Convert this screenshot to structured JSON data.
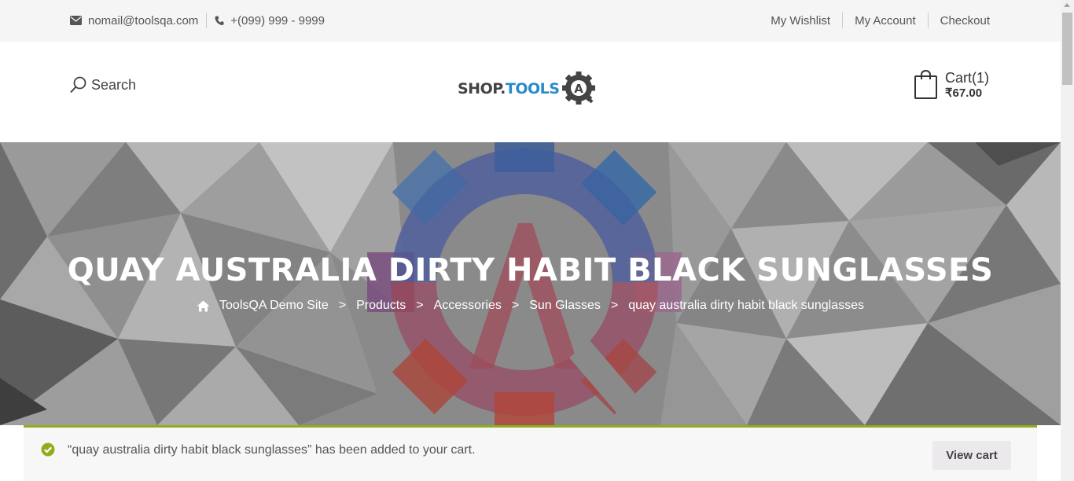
{
  "topbar": {
    "email": "nomail@toolsqa.com",
    "phone": "+(099) 999 - 9999",
    "links": [
      "My Wishlist",
      "My Account",
      "Checkout"
    ]
  },
  "header": {
    "search_label": "Search",
    "logo_part1": "SHOP.",
    "logo_part2": "TOOLS",
    "logo_badge": "A",
    "cart_label": "Cart(1)",
    "cart_amount": "₹67.00"
  },
  "hero": {
    "title": "QUAY AUSTRALIA DIRTY HABIT BLACK SUNGLASSES",
    "breadcrumb": [
      "ToolsQA Demo Site",
      "Products",
      "Accessories",
      "Sun Glasses",
      "quay australia dirty habit black sunglasses"
    ],
    "separator": ">"
  },
  "notice": {
    "message": "“quay australia dirty habit black sunglasses” has been added to your cart.",
    "button": "View cart"
  },
  "colors": {
    "accent_blue": "#2a8bc9",
    "notice_border": "#8fae1b",
    "check_green": "#8fae1b"
  },
  "icons": [
    "envelope-icon",
    "phone-icon",
    "search-icon",
    "cart-bag-icon",
    "home-icon",
    "check-circle-icon"
  ]
}
